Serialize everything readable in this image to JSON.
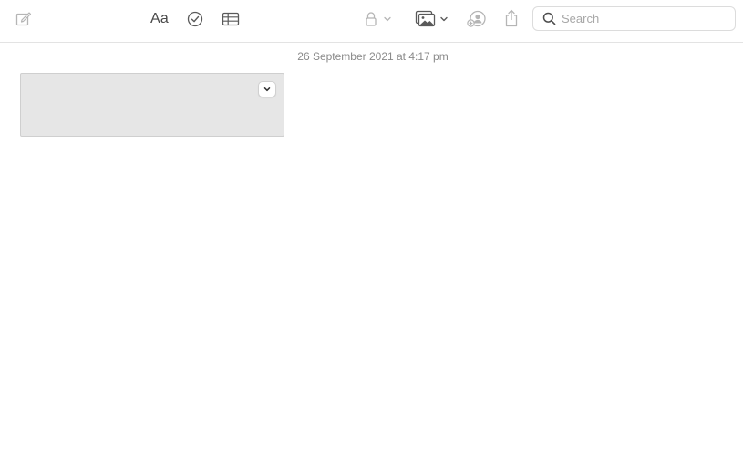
{
  "toolbar": {
    "font_button_label": "Aa",
    "icons": {
      "compose": "compose-icon",
      "format": "text-format-icon",
      "checklist": "checklist-icon",
      "table": "table-icon",
      "lock": "lock-icon",
      "media": "photo-media-icon",
      "collaborate": "add-people-icon",
      "share": "share-icon",
      "search": "search-icon"
    },
    "icon_color": "#5a5a5a",
    "disabled_icon_color": "#b5b5b5"
  },
  "search": {
    "placeholder": "Search",
    "value": ""
  },
  "note": {
    "date": "26 September 2021 at 4:17 pm"
  },
  "attachment": {
    "background": "#e6e6e6"
  }
}
